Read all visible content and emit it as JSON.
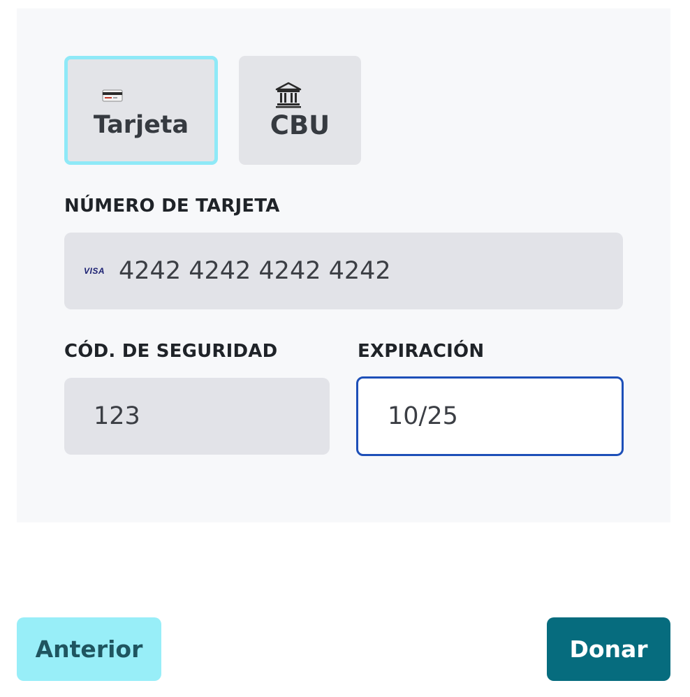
{
  "payment_methods": [
    {
      "label": "Tarjeta",
      "icon": "credit-card-icon",
      "selected": true
    },
    {
      "label": "CBU",
      "icon": "bank-icon",
      "selected": false
    }
  ],
  "card_number": {
    "label": "NÚMERO DE TARJETA",
    "brand": "VISA",
    "value": "4242 4242 4242 4242"
  },
  "security_code": {
    "label": "CÓD. DE SEGURIDAD",
    "value": "123"
  },
  "expiration": {
    "label": "EXPIRACIÓN",
    "value": "10/25"
  },
  "buttons": {
    "previous": "Anterior",
    "submit": "Donar"
  },
  "colors": {
    "selected_border": "#8fe9f7",
    "focus_border": "#1d4fb8",
    "primary_button": "#066c7e",
    "secondary_button": "#98eef8"
  }
}
